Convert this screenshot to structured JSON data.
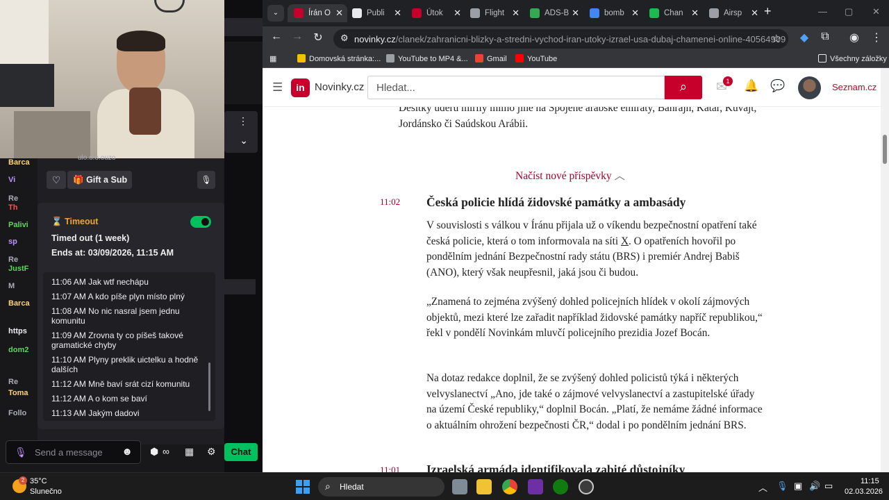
{
  "stream": {
    "ended_label": "ulo.o.o.ouzo",
    "gift_label": "Gift a Sub",
    "left_names": [
      {
        "text": "Barca",
        "color": "#ffd37a"
      },
      {
        "text": "Vi",
        "color": "#bf94ff"
      },
      {
        "text": "Re",
        "color": "#adadb8"
      },
      {
        "text": "Th",
        "color": "#ff4f4f"
      },
      {
        "text": "Palivi",
        "color": "#5cd65c"
      },
      {
        "text": "sp",
        "color": "#bf94ff"
      },
      {
        "text": "Re",
        "color": "#adadb8"
      },
      {
        "text": "JustF",
        "color": "#5cd65c"
      },
      {
        "text": "M",
        "color": "#adadb8"
      },
      {
        "text": "Barca",
        "color": "#ffd37a"
      },
      {
        "text": "https",
        "color": "#efeff1"
      },
      {
        "text": "dom2",
        "color": "#5cd65c"
      },
      {
        "text": "Re",
        "color": "#adadb8"
      },
      {
        "text": "Toma",
        "color": "#ffd37a"
      },
      {
        "text": "Follo",
        "color": "#adadb8"
      }
    ],
    "timeout": {
      "title": "Timeout",
      "status": "Timed out (1 week)",
      "ends": "Ends at: 03/09/2026, 11:15 AM",
      "messages": [
        "11:06 AM Jak wtf nechápu",
        "11:07 AM A kdo píše plyn místo plný",
        "11:08 AM No nic nasral jsem jednu komunitu",
        "11:09 AM Zrovna ty co píšeš takové gramatické chyby",
        "11:10 AM Plyny preklik uictelku a hodně dalších",
        "11:12 AM Mně baví srát cizí komunitu",
        "11:12 AM A o kom se baví",
        "11:13 AM Jakým dadovi"
      ]
    },
    "chat_placeholder": "Send a message",
    "chat_button": "Chat"
  },
  "browser": {
    "tabs": [
      {
        "label": "Írán O",
        "color": "#c6002a",
        "active": true
      },
      {
        "label": "Publi",
        "color": "#e8eaed",
        "active": false
      },
      {
        "label": "Útok",
        "color": "#c6002a",
        "active": false
      },
      {
        "label": "Flight",
        "color": "#9aa0a6",
        "active": false
      },
      {
        "label": "ADS-B",
        "color": "#34a853",
        "active": false
      },
      {
        "label": "bomb",
        "color": "#4285f4",
        "active": false
      },
      {
        "label": "Chan",
        "color": "#1db954",
        "active": false
      },
      {
        "label": "Airsp",
        "color": "#9aa0a6",
        "active": false
      }
    ],
    "url_host": "novinky.cz",
    "url_path": "/clanek/zahranicni-blizky-a-stredni-vychod-iran-utoky-izrael-usa-dubaj-chamenei-online-40564909",
    "bookmarks": [
      {
        "label": "Domovská stránka:...",
        "color": "#f2c200"
      },
      {
        "label": "YouTube to MP4 &...",
        "color": "#9aa0a6"
      },
      {
        "label": "Gmail",
        "color": "#ea4335"
      },
      {
        "label": "YouTube",
        "color": "#ff0000"
      }
    ],
    "all_bookmarks": "Všechny záložky"
  },
  "site": {
    "logo_mark": "in",
    "logo_text": "Novinky.cz",
    "search_placeholder": "Hledat...",
    "mail_count": "1",
    "seznam_label": "Seznam.cz"
  },
  "article": {
    "intro": "Desítky úderů mířily mimo jiné na Spojené arabské emiráty, Bahrajn, Katar, Kuvajt, Jordánsko či Saúdskou Arábii.",
    "load_more": "Načíst nové příspěvky",
    "time1": "11:02",
    "headline1": "Česká policie hlídá židovské památky a ambasády",
    "p1_before": "V souvislosti s válkou v Íránu přijala už o víkendu bezpečnostní opatření také česká policie, která o tom informovala na síti ",
    "p1_link": "X",
    "p1_after": ". O opatřeních hovořil po pondělním jednání Bezpečnostní rady státu (BRS) i premiér Andrej Babiš (ANO), který však neupřesnil, jaká jsou či budou.",
    "p2": "„Znamená to zejména zvýšený dohled policejních hlídek v okolí zájmových objektů, mezi které lze zařadit například židovské památky napříč republikou,“ řekl v pondělí Novinkám mluvčí policejního prezidia Jozef Bocán.",
    "p3": "Na dotaz redakce doplnil, že se zvýšený dohled policistů týká i některých velvyslanectví „Ano, jde také o zájmové velvyslanectví a zastupitelské úřady na území České republiky,“ doplnil Bocán. „Platí, že nemáme žádné informace o aktuálním ohrožení bezpečnosti ČR,“ dodal i po pondělním jednání BRS.",
    "time2": "11:01",
    "headline2": "Izraelská armáda identifikovala zabité důstojníky"
  },
  "taskbar": {
    "weather_badge": "2",
    "temp": "35°C",
    "condition": "Slunečno",
    "search_label": "Hledat",
    "time": "11:15",
    "date": "02.03.2026"
  }
}
